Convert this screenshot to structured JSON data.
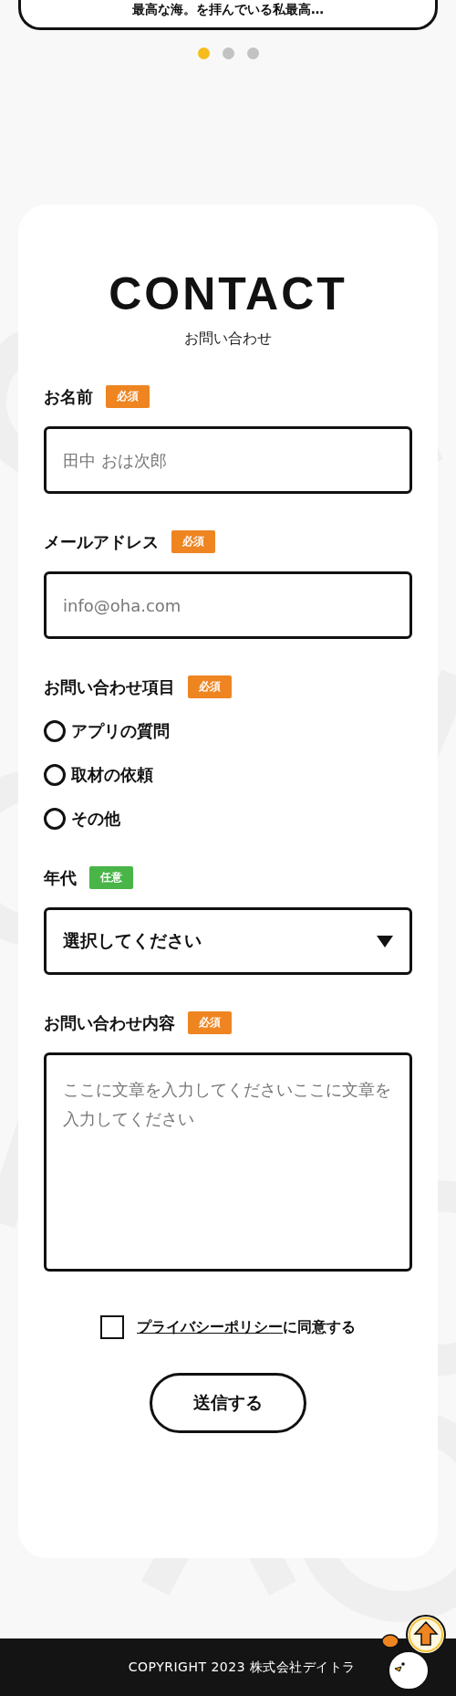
{
  "slider": {
    "card_text": "最高な海。を拝んでいる私最高…",
    "dots": [
      {
        "selected": true
      },
      {
        "selected": false
      },
      {
        "selected": false
      }
    ]
  },
  "contact": {
    "title": "CONTACT",
    "subtitle": "お問い合わせ",
    "fields": [
      {
        "kind": "text",
        "label": "お名前",
        "badge": "必須",
        "required": true,
        "placeholder": "田中 おは次郎"
      },
      {
        "kind": "text",
        "label": "メールアドレス",
        "badge": "必須",
        "required": true,
        "placeholder": "info@oha.com"
      },
      {
        "kind": "radio",
        "label": "お問い合わせ項目",
        "badge": "必須",
        "required": true,
        "options": [
          {
            "label": "アプリの質問",
            "selected": false
          },
          {
            "label": "取材の依頼",
            "selected": false
          },
          {
            "label": "その他",
            "selected": false
          }
        ]
      },
      {
        "kind": "select",
        "label": "年代",
        "badge": "任意",
        "required": false,
        "value": "選択してください"
      },
      {
        "kind": "textarea",
        "label": "お問い合わせ内容",
        "badge": "必須",
        "required": true,
        "placeholder": "ここに文章を入力してくださいここに文章を入力してください"
      }
    ],
    "agree": {
      "link": "プライバシーポリシー",
      "text": "に同意する",
      "checked": false
    },
    "submit": "送信する"
  },
  "footer": {
    "copyright": "COPYRIGHT 2023 株式会社デイトラ"
  }
}
